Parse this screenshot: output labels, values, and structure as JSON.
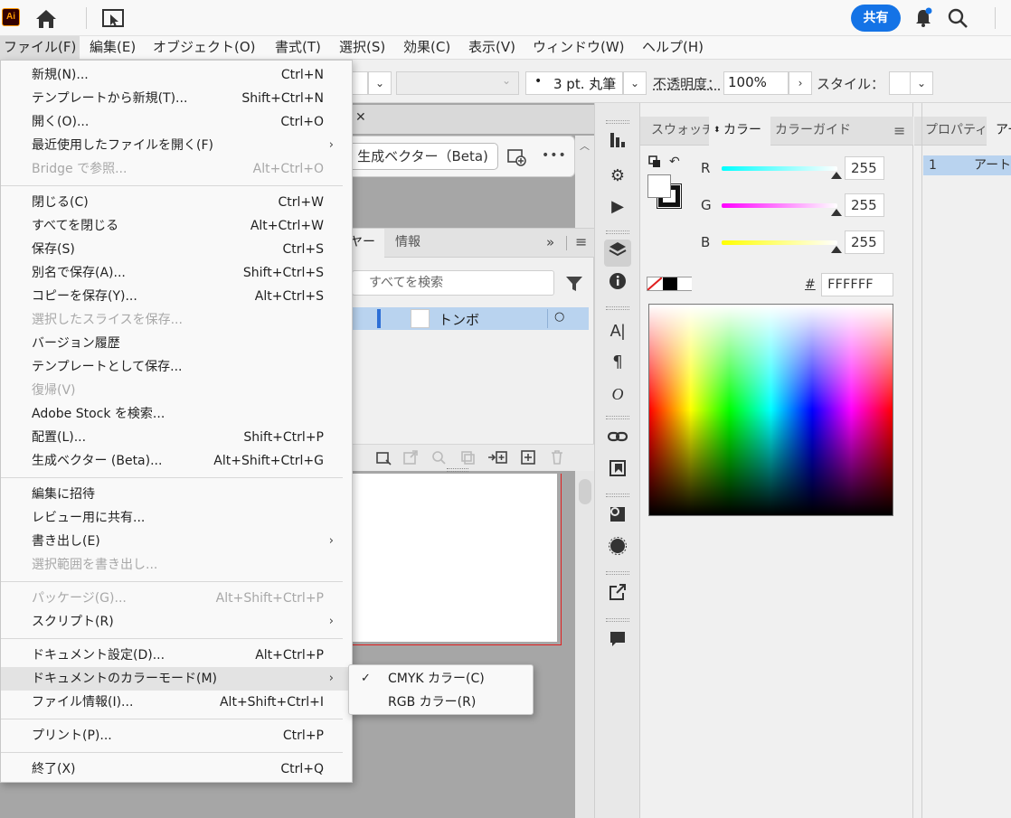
{
  "app": {
    "logo_text": "Ai",
    "share_label": "共有"
  },
  "menubar": [
    "ファイル(F)",
    "編集(E)",
    "オブジェクト(O)",
    "書式(T)",
    "選択(S)",
    "効果(C)",
    "表示(V)",
    "ウィンドウ(W)",
    "ヘルプ(H)"
  ],
  "controlbar": {
    "stroke_bullet": "•",
    "stroke_profile": "3 pt. 丸筆",
    "opacity_label": "不透明度：",
    "opacity_value": "100%",
    "style_label": "スタイル："
  },
  "doc": {
    "close_symbol": "✕",
    "gen_vector_label": "生成ベクター（Beta)",
    "more_symbol": "•••"
  },
  "layers": {
    "tab_partial": "ヤー",
    "tab_info": "情報",
    "expand_symbol": "»",
    "search_placeholder": "すべてを検索",
    "layer_name": "トンボ",
    "layer_target": "○"
  },
  "file_menu": {
    "groups": [
      [
        {
          "label": "新規(N)...",
          "shortcut": "Ctrl+N",
          "submenu": false,
          "disabled": false
        },
        {
          "label": "テンプレートから新規(T)...",
          "shortcut": "Shift+Ctrl+N",
          "submenu": false,
          "disabled": false
        },
        {
          "label": "開く(O)...",
          "shortcut": "Ctrl+O",
          "submenu": false,
          "disabled": false
        },
        {
          "label": "最近使用したファイルを開く(F)",
          "shortcut": "",
          "submenu": true,
          "disabled": false
        },
        {
          "label": "Bridge で参照...",
          "shortcut": "Alt+Ctrl+O",
          "submenu": false,
          "disabled": true
        }
      ],
      [
        {
          "label": "閉じる(C)",
          "shortcut": "Ctrl+W",
          "submenu": false,
          "disabled": false
        },
        {
          "label": "すべてを閉じる",
          "shortcut": "Alt+Ctrl+W",
          "submenu": false,
          "disabled": false
        },
        {
          "label": "保存(S)",
          "shortcut": "Ctrl+S",
          "submenu": false,
          "disabled": false
        },
        {
          "label": "別名で保存(A)...",
          "shortcut": "Shift+Ctrl+S",
          "submenu": false,
          "disabled": false
        },
        {
          "label": "コピーを保存(Y)...",
          "shortcut": "Alt+Ctrl+S",
          "submenu": false,
          "disabled": false
        },
        {
          "label": "選択したスライスを保存...",
          "shortcut": "",
          "submenu": false,
          "disabled": true
        },
        {
          "label": "バージョン履歴",
          "shortcut": "",
          "submenu": false,
          "disabled": false
        },
        {
          "label": "テンプレートとして保存...",
          "shortcut": "",
          "submenu": false,
          "disabled": false
        },
        {
          "label": "復帰(V)",
          "shortcut": "",
          "submenu": false,
          "disabled": true
        },
        {
          "label": "Adobe Stock を検索...",
          "shortcut": "",
          "submenu": false,
          "disabled": false
        },
        {
          "label": "配置(L)...",
          "shortcut": "Shift+Ctrl+P",
          "submenu": false,
          "disabled": false
        },
        {
          "label": "生成ベクター (Beta)...",
          "shortcut": "Alt+Shift+Ctrl+G",
          "submenu": false,
          "disabled": false
        }
      ],
      [
        {
          "label": "編集に招待",
          "shortcut": "",
          "submenu": false,
          "disabled": false
        },
        {
          "label": "レビュー用に共有...",
          "shortcut": "",
          "submenu": false,
          "disabled": false
        },
        {
          "label": "書き出し(E)",
          "shortcut": "",
          "submenu": true,
          "disabled": false
        },
        {
          "label": "選択範囲を書き出し...",
          "shortcut": "",
          "submenu": false,
          "disabled": true
        }
      ],
      [
        {
          "label": "パッケージ(G)...",
          "shortcut": "Alt+Shift+Ctrl+P",
          "submenu": false,
          "disabled": true
        },
        {
          "label": "スクリプト(R)",
          "shortcut": "",
          "submenu": true,
          "disabled": false
        }
      ],
      [
        {
          "label": "ドキュメント設定(D)...",
          "shortcut": "Alt+Ctrl+P",
          "submenu": false,
          "disabled": false
        },
        {
          "label": "ドキュメントのカラーモード(M)",
          "shortcut": "",
          "submenu": true,
          "disabled": false,
          "highlighted": true
        },
        {
          "label": "ファイル情報(I)...",
          "shortcut": "Alt+Shift+Ctrl+I",
          "submenu": false,
          "disabled": false
        }
      ],
      [
        {
          "label": "プリント(P)...",
          "shortcut": "Ctrl+P",
          "submenu": false,
          "disabled": false
        }
      ],
      [
        {
          "label": "終了(X)",
          "shortcut": "Ctrl+Q",
          "submenu": false,
          "disabled": false
        }
      ]
    ]
  },
  "color_mode_submenu": [
    {
      "label": "CMYK カラー(C)",
      "checked": true
    },
    {
      "label": "RGB カラー(R)",
      "checked": false
    }
  ],
  "color_panel": {
    "tabs": [
      "スウォッチ",
      "カラー",
      "カラーガイド"
    ],
    "active_tab": "カラー",
    "channels": [
      {
        "name": "R",
        "value": "255",
        "color": "#00ffff"
      },
      {
        "name": "G",
        "value": "255",
        "color": "#ff00ff"
      },
      {
        "name": "B",
        "value": "255",
        "color": "#ffff00"
      }
    ],
    "hex_label": "#",
    "hex_value": "FFFFFF"
  },
  "properties_panel": {
    "tabs": [
      "プロパティ",
      "アー"
    ],
    "row_index": "1",
    "row_name": "アート"
  },
  "colors": {
    "accent": "#1473e6",
    "menu_hover": "#e3e3e3",
    "selection": "#b9d3ef",
    "artboard_border": "#e02020"
  }
}
